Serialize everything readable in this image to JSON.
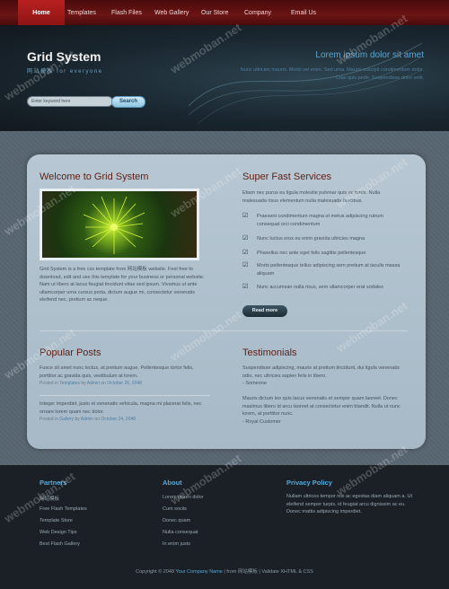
{
  "nav": {
    "items": [
      "Home",
      "Templates",
      "Flash Files",
      "Web Gallery",
      "Our Store",
      "Company",
      "Email Us"
    ]
  },
  "header": {
    "site_title": "Grid System",
    "site_subtitle": "网站模板 for everyone",
    "hero_title": "Lorem ipsum dolor sit amet",
    "hero_text": "Nunc ultricies mauris. Morbi vel enim. Sed urna. Mauris suscipit condimentum dolor. Cras quis pede. Suspendisse dolor velit.",
    "search_placeholder": "Enter keyword here",
    "search_button": "Search"
  },
  "welcome": {
    "title": "Welcome to Grid System",
    "image_icon": "dandelion-photo",
    "text": "Grid System is a free css template from 网站模板 website. Feel free to download, edit and use this template for your business or personal website. Nam ut libero at lacus feugiat tincidunt vitae sed ipsum. Vivamus ut ante ullamcorper urna cursus porta, dictum augue mi, consectetur venenatis eleifend nec, pretium ac neque."
  },
  "services": {
    "title": "Super Fast Services",
    "intro": "Etiam nec purus eu ligula molestie pulvinar quis ac tortor. Nulla malesuada risus elementum nulla malesuada faucibus.",
    "check_icon": "checkbox-checked-icon",
    "items": [
      "Praesent condimentum magna ut metus adipiscing rutrum consequat orci condimentum",
      "Nunc luctus eros eu enim gravida ultricies magna",
      "Phasellus nec ante eget felis sagittis pellentesque",
      "Morbi pellentesque tellus adipiscing sem pretium at iaculis massa aliquam",
      "Nunc accumsan nulla risus, sem ullamcorper erat sodales"
    ],
    "read_more": "Read more"
  },
  "posts": {
    "title": "Popular Posts",
    "items": [
      {
        "text": "Fusce sit amet nunc lectus, at pretium augue. Pellentesque tortor felis, porttitor ac gravida quis, vestibulum at lorem.",
        "posted_in": "Posted in",
        "category": "Templates",
        "by": "by",
        "author": "Admin",
        "on": "on",
        "date": "October 26, 2048"
      },
      {
        "text": "Integer imperdiet, justo et venenatis vehicula, magna mi placerat felis, nec ornare lorem quam nec dolor.",
        "posted_in": "Posted in",
        "category": "Gallery",
        "by": "by",
        "author": "Admin",
        "on": "on",
        "date": "October 24, 2048"
      }
    ]
  },
  "testimonials": {
    "title": "Testimonials",
    "items": [
      {
        "text": "Suspendisse adipiscing, mauris at pretium tincidunt, dui ligula venenatis odio, nec ultricies sapien felis in libero.",
        "author": "- Someone"
      },
      {
        "text": "Mauris dictum leo quis lacus venenatis et semper quam laoreet. Donec maximus libero id arcu laoreet at consectetur enim blandit. Nulla ut nunc lorem, at porttitor nunc.",
        "author": "- Royal Customer"
      }
    ]
  },
  "footer": {
    "partners": {
      "title": "Partners",
      "links": [
        "网站模板",
        "Free Flash Templates",
        "Template Store",
        "Web Design Tips",
        "Best Flash Gallery"
      ]
    },
    "about": {
      "title": "About",
      "links": [
        "Lorem ipsum dolor",
        "Cum sociis",
        "Donec quam",
        "Nulla consequat",
        "In enim justo"
      ]
    },
    "privacy": {
      "title": "Privacy Policy",
      "text": "Nullam ultrices tempor nisi ac egestas diam aliquam a. Ut eleifend semper turpis, id feugiat arcu dignissim ac eu. Donec mattis adipiscing imperdiet."
    },
    "copyright_prefix": "Copyright © 2048",
    "company": "Your Company Name",
    "copyright_suffix": "| from 网站模板 | Validate XHTML & CSS"
  },
  "watermark": "webmoban.net",
  "colors": {
    "nav_red": "#8e1515",
    "accent_blue": "#5aa7d6",
    "heading_brown": "#5b1f14"
  }
}
